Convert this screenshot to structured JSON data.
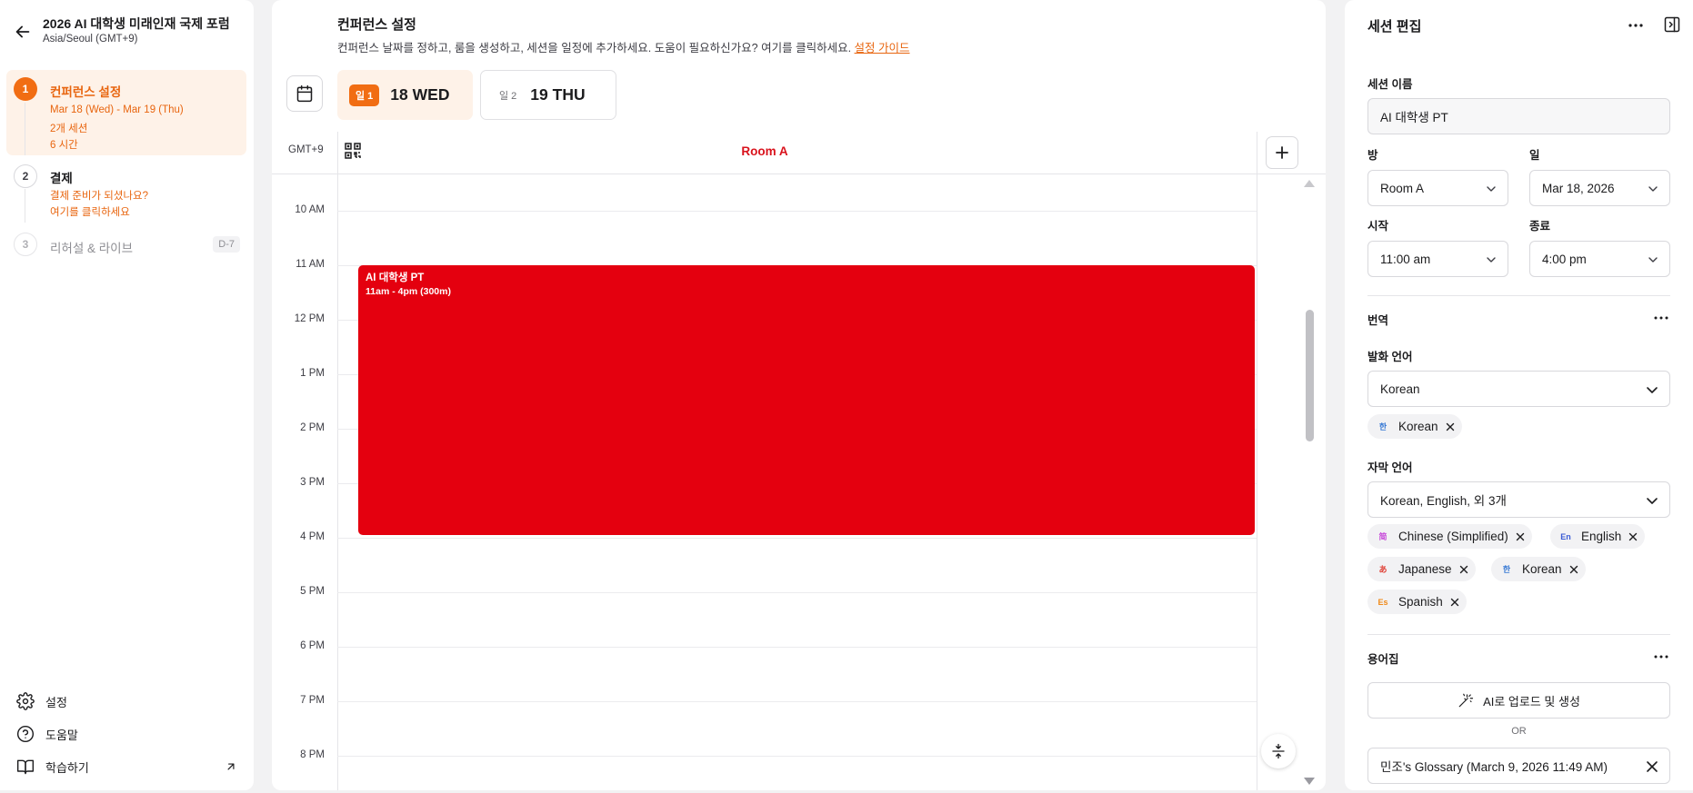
{
  "sidebar": {
    "title": "2026 AI 대학생 미래인재 국제 포럼",
    "timezone": "Asia/Seoul (GMT+9)",
    "steps": [
      {
        "num": "1",
        "title": "컨퍼런스 설정",
        "lines": [
          "Mar 18 (Wed) - Mar 19 (Thu)",
          "2개 세션",
          "6 시간"
        ]
      },
      {
        "num": "2",
        "title": "결제",
        "lines": [
          "결제 준비가 되셨나요?",
          "여기를 클릭하세요"
        ]
      },
      {
        "num": "3",
        "title": "리허설 & 라이브",
        "badge": "D-7"
      }
    ],
    "footer": {
      "settings": "설정",
      "help": "도움말",
      "learn": "학습하기"
    }
  },
  "main": {
    "title": "컨퍼런스 설정",
    "desc": "컨퍼런스 날짜를 정하고, 룸을 생성하고, 세션을 일정에 추가하세요. 도움이 필요하신가요? 여기를 클릭하세요.",
    "guide_link": "설정 가이드",
    "days": [
      {
        "badge": "일 1",
        "label": "18 WED"
      },
      {
        "badge": "일 2",
        "label": "19 THU"
      }
    ],
    "gmt": "GMT+9",
    "room": "Room A",
    "times": [
      "10 AM",
      "11 AM",
      "12 PM",
      "1 PM",
      "2 PM",
      "3 PM",
      "4 PM",
      "5 PM",
      "6 PM",
      "7 PM",
      "8 PM"
    ],
    "event": {
      "title": "AI 대학생 PT",
      "time": "11am - 4pm (300m)",
      "color": "#e4000f"
    }
  },
  "panel": {
    "title": "세션 편집",
    "session_name_label": "세션 이름",
    "session_name": "AI 대학생 PT",
    "room_label": "방",
    "room_value": "Room A",
    "day_label": "일",
    "day_value": "Mar 18, 2026",
    "start_label": "시작",
    "start_value": "11:00 am",
    "end_label": "종료",
    "end_value": "4:00 pm",
    "translation_label": "번역",
    "spoken_label": "발화 언어",
    "spoken_value": "Korean",
    "spoken_chips": [
      {
        "flag": "한",
        "label": "Korean",
        "flag_color": "#3a7bd5"
      }
    ],
    "subtitle_label": "자막 언어",
    "subtitle_value": "Korean, English, 외 3개",
    "subtitle_chips": [
      {
        "flag": "简",
        "label": "Chinese (Simplified)",
        "flag_color": "#c74bd9"
      },
      {
        "flag": "En",
        "label": "English",
        "flag_color": "#3a5bd5"
      },
      {
        "flag": "あ",
        "label": "Japanese",
        "flag_color": "#e0443a"
      },
      {
        "flag": "한",
        "label": "Korean",
        "flag_color": "#3a7bd5"
      },
      {
        "flag": "Es",
        "label": "Spanish",
        "flag_color": "#f08a1a"
      }
    ],
    "glossary_label": "용어집",
    "ai_button": "AI로 업로드 및 생성",
    "or": "OR",
    "glossary_value": "민조's Glossary (March 9, 2026 11:49 AM)"
  },
  "colors": {
    "accent": "#f16d13",
    "event": "#e4000f",
    "room": "#d9121c"
  }
}
